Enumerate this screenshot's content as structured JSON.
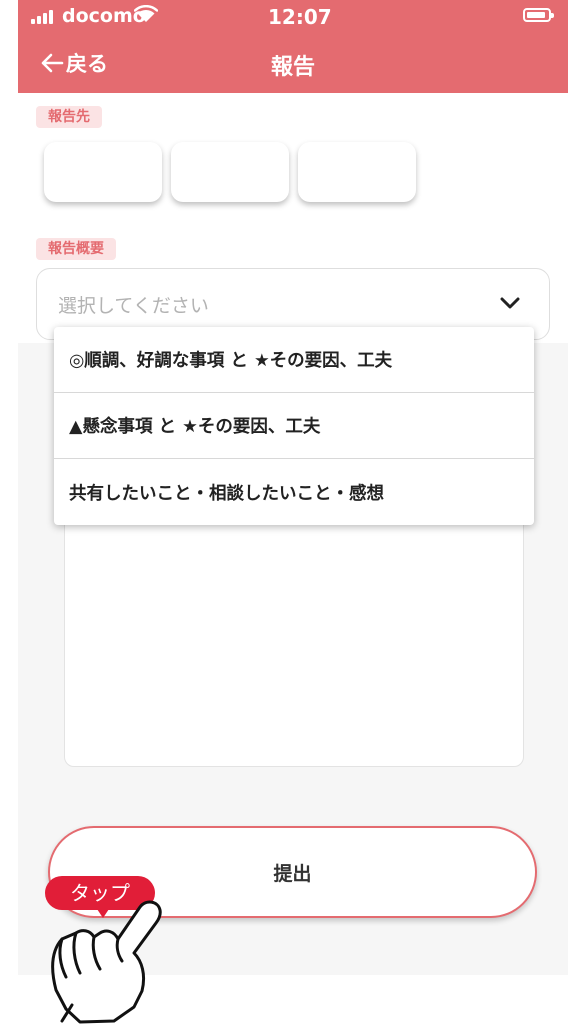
{
  "status_bar": {
    "carrier": "docomo",
    "time": "12:07",
    "signal_icon": "signal-bars-icon",
    "wifi_icon": "wifi-icon",
    "battery_icon": "battery-icon"
  },
  "nav": {
    "back_label": "戻る",
    "back_icon": "arrow-left-icon",
    "title": "報告"
  },
  "form": {
    "recipient_label": "報告先",
    "recipients": [
      "",
      "",
      ""
    ],
    "summary_label": "報告概要",
    "summary_placeholder": "選択してください",
    "chevron_icon": "chevron-down-icon"
  },
  "dropdown": {
    "options": [
      "◎順調、好調な事項 と ★その要因、工夫",
      "▲懸念事項 と ★その要因、工夫",
      "共有したいこと・相談したいこと・感想"
    ]
  },
  "submit": {
    "label": "提出"
  },
  "overlay": {
    "tap_label": "タップ",
    "hand_icon": "pointing-hand-icon"
  },
  "colors": {
    "brand": "#e46b70",
    "label_bg": "#fbe3e4",
    "tap_badge": "#e11e38"
  }
}
